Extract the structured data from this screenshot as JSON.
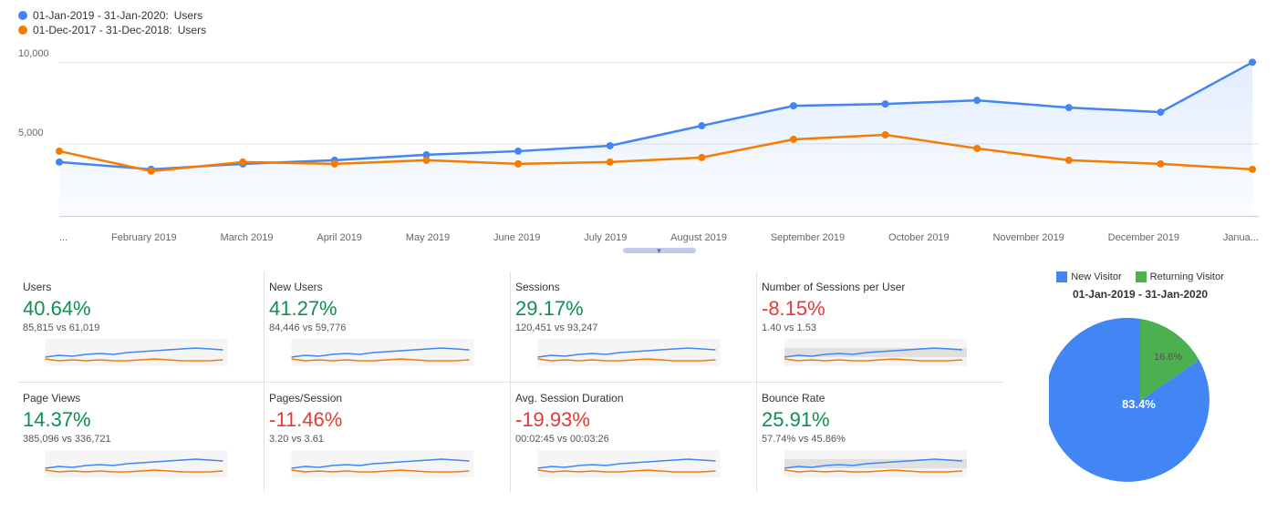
{
  "legend": {
    "line1": {
      "label": "01-Jan-2019 - 31-Jan-2020:",
      "series": "Users",
      "color": "blue"
    },
    "line2": {
      "label": "01-Dec-2017 - 31-Dec-2018:",
      "series": "Users",
      "color": "orange"
    }
  },
  "xaxis": {
    "labels": [
      "...",
      "February 2019",
      "March 2019",
      "April 2019",
      "May 2019",
      "June 2019",
      "July 2019",
      "August 2019",
      "September 2019",
      "October 2019",
      "November 2019",
      "December 2019",
      "Janua..."
    ]
  },
  "yaxis": {
    "labels": [
      "10,000",
      "5,000"
    ]
  },
  "metrics": [
    {
      "title": "Users",
      "value": "40.64%",
      "sign": "positive",
      "compare": "85,815 vs 61,019"
    },
    {
      "title": "New Users",
      "value": "41.27%",
      "sign": "positive",
      "compare": "84,446 vs 59,776"
    },
    {
      "title": "Sessions",
      "value": "29.17%",
      "sign": "positive",
      "compare": "120,451 vs 93,247"
    },
    {
      "title": "Number of Sessions per User",
      "value": "-8.15%",
      "sign": "negative",
      "compare": "1.40 vs 1.53"
    },
    {
      "title": "Page Views",
      "value": "14.37%",
      "sign": "positive",
      "compare": "385,096 vs 336,721"
    },
    {
      "title": "Pages/Session",
      "value": "-11.46%",
      "sign": "negative",
      "compare": "3.20 vs 3.61"
    },
    {
      "title": "Avg. Session Duration",
      "value": "-19.93%",
      "sign": "negative",
      "compare": "00:02:45 vs 00:03:26"
    },
    {
      "title": "Bounce Rate",
      "value": "25.91%",
      "sign": "positive",
      "compare": "57.74% vs 45.86%"
    }
  ],
  "pie": {
    "legend": {
      "new_visitor": "New Visitor",
      "returning_visitor": "Returning Visitor"
    },
    "title": "01-Jan-2019 - 31-Jan-2020",
    "new_pct": 83.4,
    "returning_pct": 16.6,
    "new_label": "83.4%",
    "returning_label": "16.6%"
  }
}
